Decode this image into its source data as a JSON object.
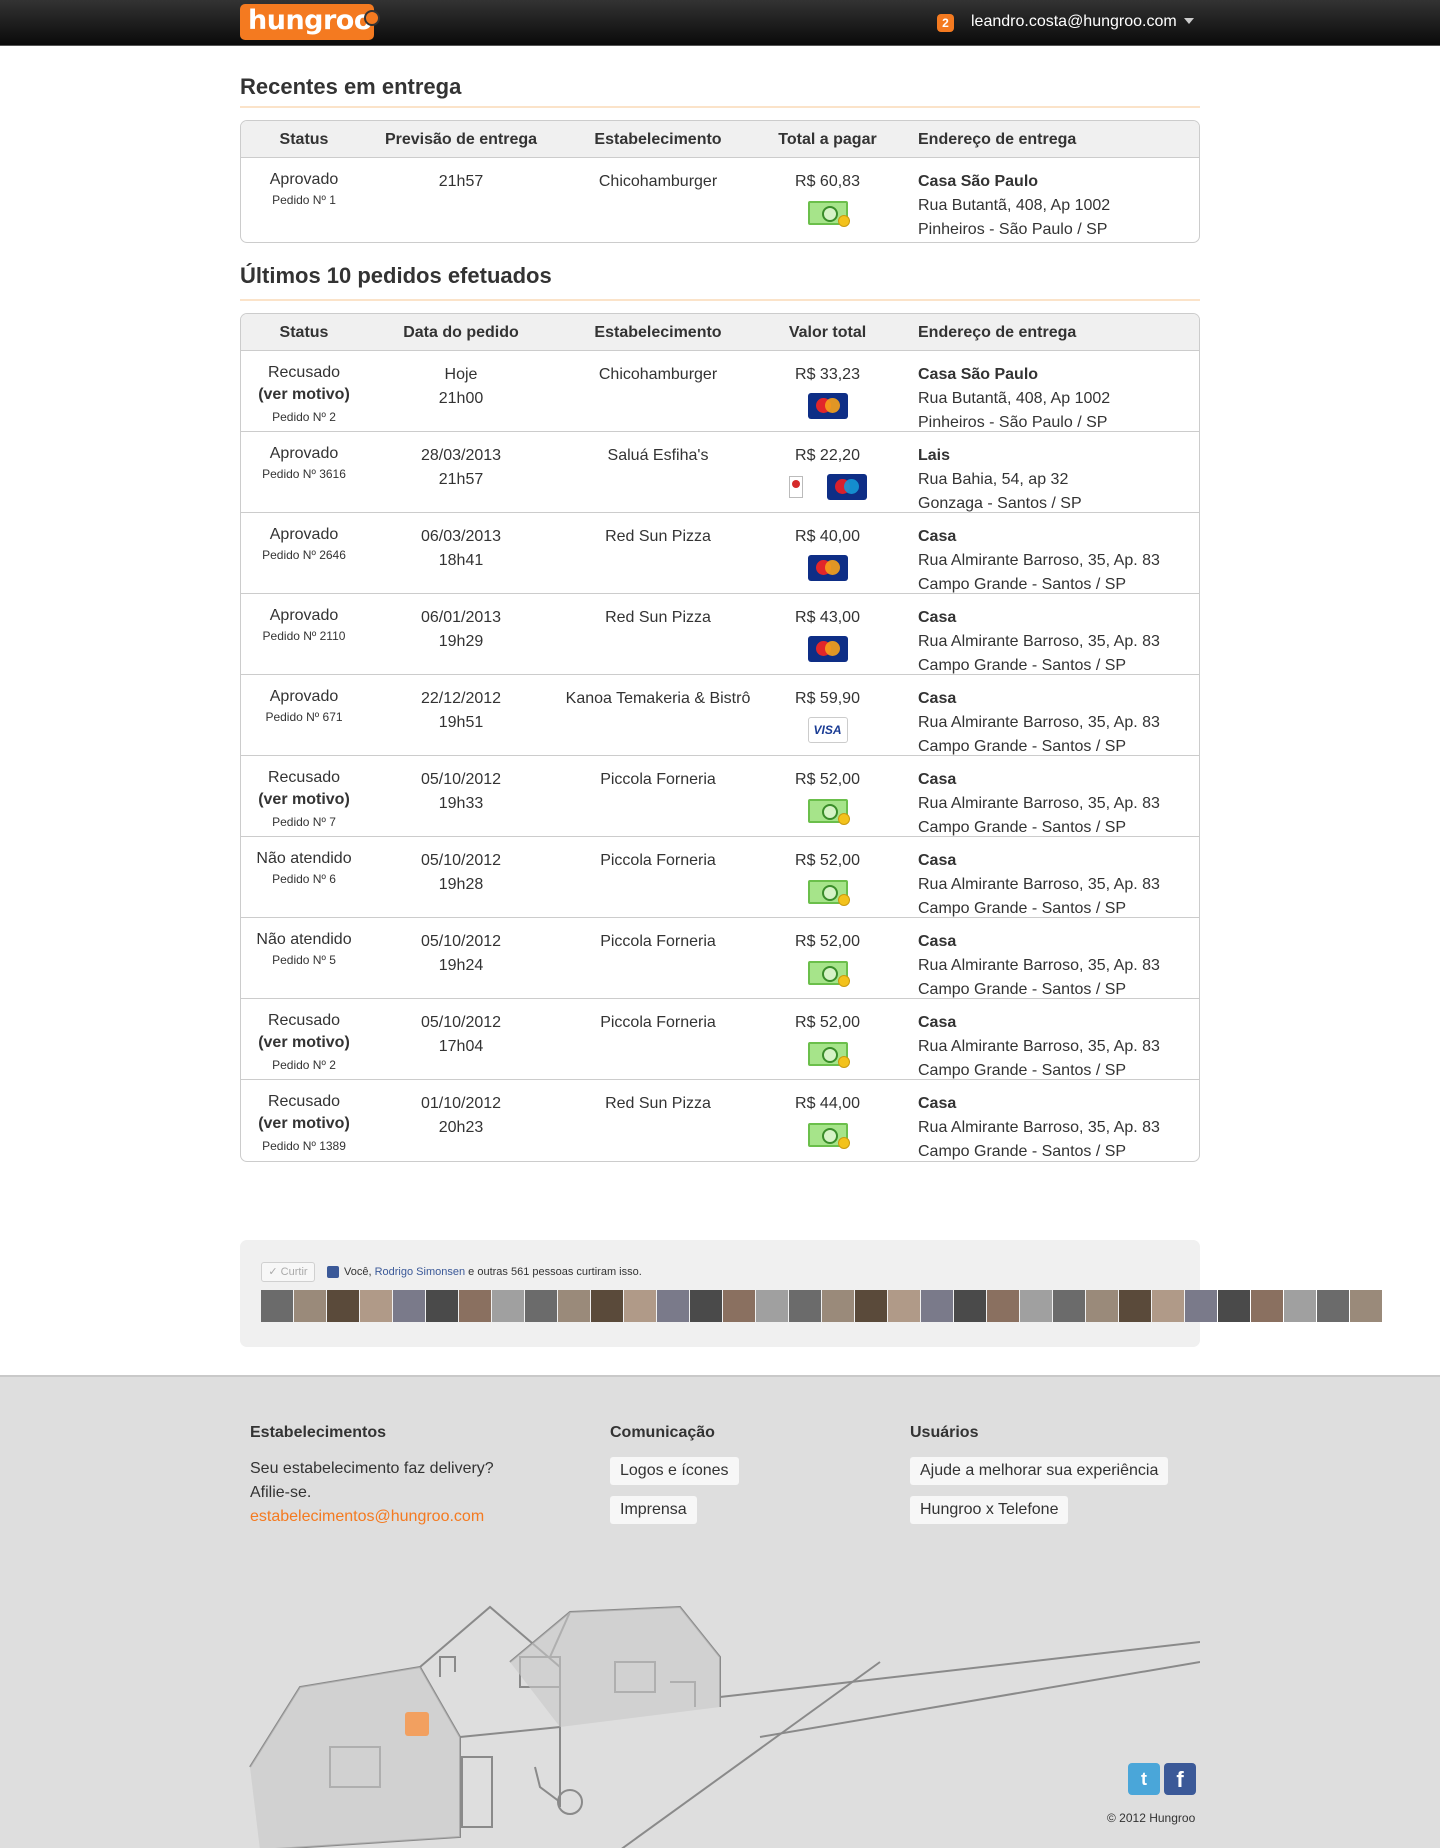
{
  "header": {
    "logo": "hungroo",
    "notifications": "2",
    "user_email": "leandro.costa@hungroo.com"
  },
  "recent": {
    "title": "Recentes em entrega",
    "columns": [
      "Status",
      "Previsão de entrega",
      "Estabelecimento",
      "Total a pagar",
      "Endereço de entrega"
    ],
    "rows": [
      {
        "status": "Aprovado",
        "order": "Pedido Nº 1",
        "time": "21h57",
        "store": "Chicohamburger",
        "total": "R$ 60,83",
        "payment": [
          "cash"
        ],
        "addr_name": "Casa São Paulo",
        "addr_line1": "Rua Butantã, 408, Ap 1002",
        "addr_line2": "Pinheiros - São Paulo / SP"
      }
    ]
  },
  "history": {
    "title": "Últimos 10 pedidos efetuados",
    "columns": [
      "Status",
      "Data do pedido",
      "Estabelecimento",
      "Valor total",
      "Endereço de entrega"
    ],
    "rows": [
      {
        "status": "Recusado",
        "motivo": "(ver motivo)",
        "order": "Pedido Nº 2",
        "date": "Hoje",
        "time": "21h00",
        "store": "Chicohamburger",
        "total": "R$ 33,23",
        "payment": [
          "mastercard"
        ],
        "addr_name": "Casa São Paulo",
        "addr_line1": "Rua Butantã, 408, Ap 1002",
        "addr_line2": "Pinheiros - São Paulo / SP"
      },
      {
        "status": "Aprovado",
        "motivo": "",
        "order": "Pedido Nº 3616",
        "date": "28/03/2013",
        "time": "21h57",
        "store": "Saluá Esfiha's",
        "total": "R$ 22,20",
        "payment": [
          "ticket",
          "maestro"
        ],
        "addr_name": "Lais",
        "addr_line1": "Rua Bahia, 54, ap 32",
        "addr_line2": "Gonzaga - Santos / SP"
      },
      {
        "status": "Aprovado",
        "motivo": "",
        "order": "Pedido Nº 2646",
        "date": "06/03/2013",
        "time": "18h41",
        "store": "Red Sun Pizza",
        "total": "R$ 40,00",
        "payment": [
          "mastercard"
        ],
        "addr_name": "Casa",
        "addr_line1": "Rua Almirante Barroso, 35, Ap. 83",
        "addr_line2": "Campo Grande - Santos / SP"
      },
      {
        "status": "Aprovado",
        "motivo": "",
        "order": "Pedido Nº 2110",
        "date": "06/01/2013",
        "time": "19h29",
        "store": "Red Sun Pizza",
        "total": "R$ 43,00",
        "payment": [
          "mastercard"
        ],
        "addr_name": "Casa",
        "addr_line1": "Rua Almirante Barroso, 35, Ap. 83",
        "addr_line2": "Campo Grande - Santos / SP"
      },
      {
        "status": "Aprovado",
        "motivo": "",
        "order": "Pedido Nº 671",
        "date": "22/12/2012",
        "time": "19h51",
        "store": "Kanoa Temakeria & Bistrô",
        "total": "R$ 59,90",
        "payment": [
          "visa"
        ],
        "addr_name": "Casa",
        "addr_line1": "Rua Almirante Barroso, 35, Ap. 83",
        "addr_line2": "Campo Grande - Santos / SP"
      },
      {
        "status": "Recusado",
        "motivo": "(ver motivo)",
        "order": "Pedido Nº 7",
        "date": "05/10/2012",
        "time": "19h33",
        "store": "Piccola Forneria",
        "total": "R$ 52,00",
        "payment": [
          "cash"
        ],
        "addr_name": "Casa",
        "addr_line1": "Rua Almirante Barroso, 35, Ap. 83",
        "addr_line2": "Campo Grande - Santos / SP"
      },
      {
        "status": "Não atendido",
        "motivo": "",
        "order": "Pedido Nº 6",
        "date": "05/10/2012",
        "time": "19h28",
        "store": "Piccola Forneria",
        "total": "R$ 52,00",
        "payment": [
          "cash"
        ],
        "addr_name": "Casa",
        "addr_line1": "Rua Almirante Barroso, 35, Ap. 83",
        "addr_line2": "Campo Grande - Santos / SP"
      },
      {
        "status": "Não atendido",
        "motivo": "",
        "order": "Pedido Nº 5",
        "date": "05/10/2012",
        "time": "19h24",
        "store": "Piccola Forneria",
        "total": "R$ 52,00",
        "payment": [
          "cash"
        ],
        "addr_name": "Casa",
        "addr_line1": "Rua Almirante Barroso, 35, Ap. 83",
        "addr_line2": "Campo Grande - Santos / SP"
      },
      {
        "status": "Recusado",
        "motivo": "(ver motivo)",
        "order": "Pedido Nº 2",
        "date": "05/10/2012",
        "time": "17h04",
        "store": "Piccola Forneria",
        "total": "R$ 52,00",
        "payment": [
          "cash"
        ],
        "addr_name": "Casa",
        "addr_line1": "Rua Almirante Barroso, 35, Ap. 83",
        "addr_line2": "Campo Grande - Santos / SP"
      },
      {
        "status": "Recusado",
        "motivo": "(ver motivo)",
        "order": "Pedido Nº 1389",
        "date": "01/10/2012",
        "time": "20h23",
        "store": "Red Sun Pizza",
        "total": "R$ 44,00",
        "payment": [
          "cash"
        ],
        "addr_name": "Casa",
        "addr_line1": "Rua Almirante Barroso, 35, Ap. 83",
        "addr_line2": "Campo Grande - Santos / SP"
      }
    ]
  },
  "facebook": {
    "like_label": "✓ Curtir",
    "text_before": "Você,",
    "friend": "Rodrigo Simonsen",
    "text_after": "e outras 561 pessoas curtiram isso.",
    "faces": 34
  },
  "footer": {
    "col1_title": "Estabelecimentos",
    "col1_line1": "Seu estabelecimento faz delivery?",
    "col1_line2": "Afilie-se.",
    "col1_email": "estabelecimentos@hungroo.com",
    "col2_title": "Comunicação",
    "col2_links": [
      "Logos e ícones",
      "Imprensa"
    ],
    "col3_title": "Usuários",
    "col3_links": [
      "Ajude a melhorar sua experiência",
      "Hungroo x Telefone"
    ],
    "copyright": "© 2012 Hungroo",
    "twitter_glyph": "t",
    "facebook_glyph": "f"
  },
  "colors": {
    "brand": "#f47a20",
    "header_bg": "#111111",
    "footer_bg": "#dedede"
  }
}
